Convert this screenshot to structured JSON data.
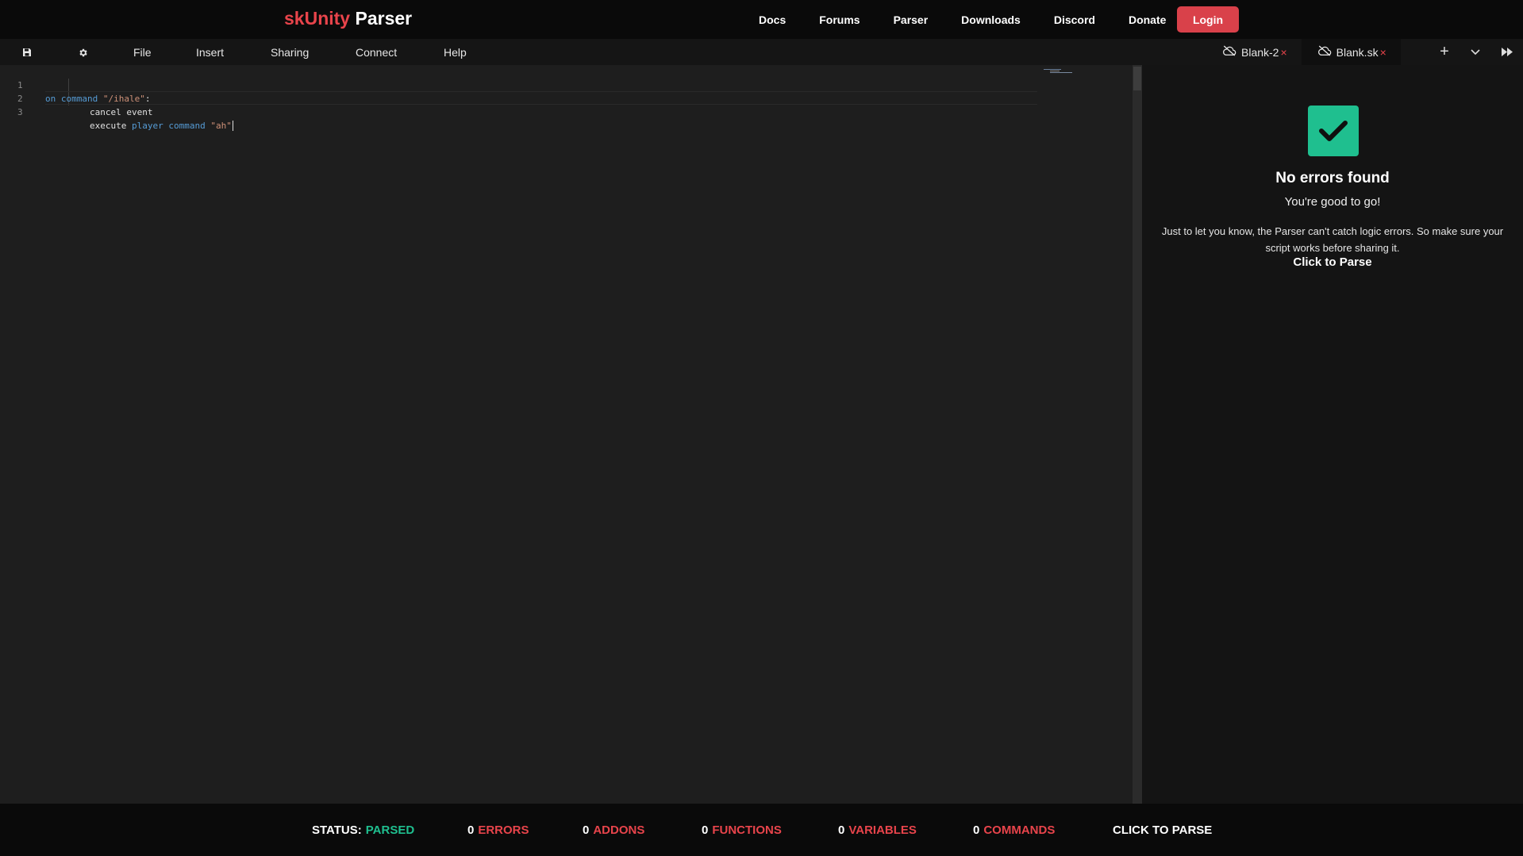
{
  "brand": {
    "prefix": "skUnity",
    "suffix": " Parser"
  },
  "nav": {
    "items": [
      "Docs",
      "Forums",
      "Parser",
      "Downloads",
      "Discord",
      "Donate"
    ],
    "login": "Login"
  },
  "toolbar": {
    "save_icon": "save-icon",
    "settings_icon": "gear-icon",
    "menus": [
      "File",
      "Insert",
      "Sharing",
      "Connect",
      "Help"
    ]
  },
  "tabs": [
    {
      "label": "Blank-2",
      "close": "×",
      "icon": "cloud-off-icon"
    },
    {
      "label": "Blank.sk",
      "close": "×",
      "icon": "cloud-off-icon"
    }
  ],
  "tab_controls": {
    "add": "+",
    "dropdown": "chevron-down-icon",
    "collapse": "fast-forward-icon"
  },
  "editor": {
    "lines": [
      {
        "num": "1",
        "a": "on command ",
        "b": "\"/ihale\"",
        "c": ":"
      },
      {
        "num": "2",
        "a": "cancel event"
      },
      {
        "num": "3",
        "a": "execute ",
        "b": "player command ",
        "c": "\"ah\""
      }
    ]
  },
  "panel": {
    "title": "No errors found",
    "subtitle": "You're good to go!",
    "note": "Just to let you know, the Parser can't catch logic errors. So make sure your script works before sharing it.",
    "link": "Click to Parse"
  },
  "status": {
    "status_label": "STATUS:",
    "status_value": "PARSED",
    "errors": {
      "n": "0",
      "label": "ERRORS"
    },
    "addons": {
      "n": "0",
      "label": "ADDONS"
    },
    "functions": {
      "n": "0",
      "label": "FUNCTIONS"
    },
    "variables": {
      "n": "0",
      "label": "VARIABLES"
    },
    "commands": {
      "n": "0",
      "label": "COMMANDS"
    },
    "parse": "CLICK TO PARSE"
  },
  "colors": {
    "accent": "#e8444b",
    "success": "#1fbf8f",
    "keyword": "#569cd6",
    "string": "#ce9178"
  }
}
